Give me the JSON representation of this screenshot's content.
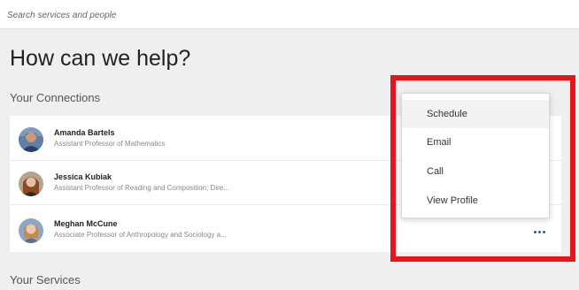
{
  "search": {
    "placeholder": "Search services and people"
  },
  "page": {
    "title": "How can we help?"
  },
  "connections": {
    "heading": "Your Connections",
    "people": [
      {
        "name": "Amanda Bartels",
        "title": "Assistant Professor of Mathematics",
        "avatar_icon": "person-avatar-photo"
      },
      {
        "name": "Jessica Kubiak",
        "title": "Assistant Professor of Reading and Composition; Dire...",
        "avatar_icon": "person-avatar-photo"
      },
      {
        "name": "Meghan McCune",
        "title": "Associate Professor of Anthropology and Sociology a...",
        "avatar_icon": "person-avatar-photo"
      }
    ],
    "more_icon": "more-horizontal-icon"
  },
  "menu": {
    "items": [
      {
        "label": "Schedule"
      },
      {
        "label": "Email"
      },
      {
        "label": "Call"
      },
      {
        "label": "View Profile"
      }
    ]
  },
  "services": {
    "heading": "Your Services"
  },
  "colors": {
    "background": "#efefef",
    "card": "#ffffff",
    "accent_dots": "#1f5fb8",
    "highlight_border": "#e8141b",
    "menu_hover": "#f3f3f3"
  }
}
